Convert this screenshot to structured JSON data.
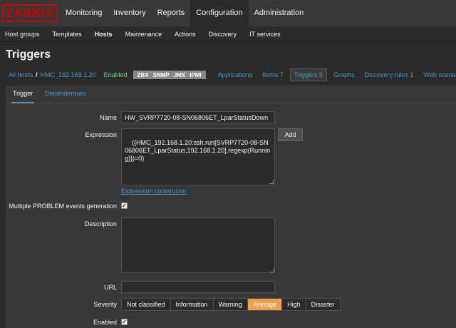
{
  "logo": "ZABBIX",
  "main_menu": [
    "Monitoring",
    "Inventory",
    "Reports",
    "Configuration",
    "Administration"
  ],
  "sub_menu": [
    "Host groups",
    "Templates",
    "Hosts",
    "Maintenance",
    "Actions",
    "Discovery",
    "IT services"
  ],
  "page_title": "Triggers",
  "host_nav": {
    "all_hosts": "All hosts",
    "separator": "/",
    "host": "HMC_192.168.1.20",
    "status": "Enabled",
    "badges": [
      "ZBX",
      "SNMP",
      "JMX",
      "IPMI"
    ],
    "tabs": [
      {
        "label": "Applications",
        "count": ""
      },
      {
        "label": "Items",
        "count": "7"
      },
      {
        "label": "Triggers",
        "count": "5"
      },
      {
        "label": "Graphs",
        "count": ""
      },
      {
        "label": "Discovery rules",
        "count": "1"
      },
      {
        "label": "Web scenarios",
        "count": ""
      }
    ]
  },
  "form_tabs": [
    "Trigger",
    "Dependencies"
  ],
  "form": {
    "name_label": "Name",
    "name_value": "HW_SVRP7720-08-SN06806ET_LparStatusDown",
    "expression_label": "Expression",
    "expression_value": "({HMC_192.168.1.20:ssh.run[SVRP7720-08-SN06806ET_LparStatus,192.168.1.20].regexp(Running)})=0)",
    "add_button": "Add",
    "expression_constructor": "Expression constructor",
    "multiple_problem_label": "Multiple PROBLEM events generation",
    "multiple_problem_checked": true,
    "description_label": "Description",
    "description_value": "",
    "url_label": "URL",
    "url_value": "",
    "severity_label": "Severity",
    "severity_options": [
      "Not classified",
      "Information",
      "Warning",
      "Average",
      "High",
      "Disaster"
    ],
    "severity_selected": "Average",
    "enabled_label": "Enabled",
    "enabled_checked": true
  },
  "colors": {
    "logo_red": "#d40000",
    "link_blue": "#4796c4",
    "enabled_green": "#59db8f",
    "severity_average": "#f0a14e"
  }
}
